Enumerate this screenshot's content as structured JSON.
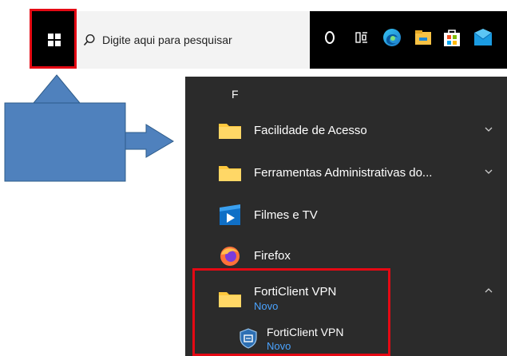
{
  "taskbar": {
    "search_placeholder": "Digite aqui para pesquisar",
    "icons": [
      "start-windows-icon",
      "search-icon",
      "cortana-icon",
      "task-view-icon",
      "edge-icon",
      "file-explorer-icon",
      "store-icon",
      "mail-icon"
    ]
  },
  "start_menu": {
    "letter_header": "F",
    "items": [
      {
        "label": "Facilidade de Acesso",
        "icon": "folder-icon",
        "expandable": true,
        "expanded": false
      },
      {
        "label": "Ferramentas Administrativas do...",
        "icon": "folder-icon",
        "expandable": true,
        "expanded": false
      },
      {
        "label": "Filmes e TV",
        "icon": "movies-tv-icon"
      },
      {
        "label": "Firefox",
        "icon": "firefox-icon"
      },
      {
        "label": "FortiClient VPN",
        "badge": "Novo",
        "icon": "folder-icon",
        "expandable": true,
        "expanded": true
      },
      {
        "label": "FortiClient VPN",
        "badge": "Novo",
        "icon": "forticlient-icon"
      }
    ]
  },
  "colors": {
    "highlight": "#e50914",
    "annotation_fill": "#4f81bd",
    "panel_bg": "#2b2b2b",
    "folder": "#ffc83d",
    "new_badge": "#4aa3ff"
  }
}
